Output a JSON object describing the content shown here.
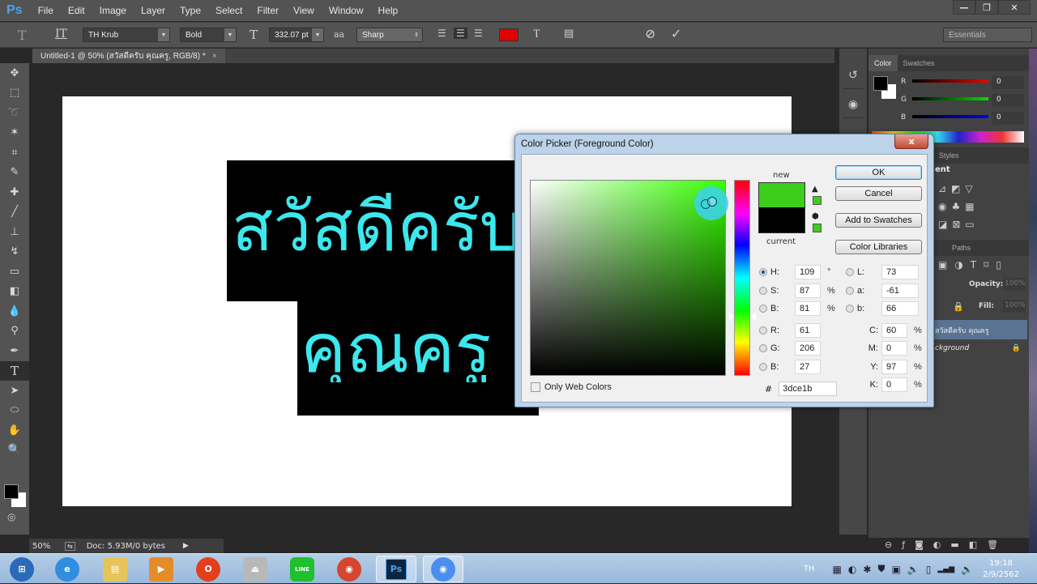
{
  "app": {
    "logo": "Ps",
    "menu": [
      "File",
      "Edit",
      "Image",
      "Layer",
      "Type",
      "Select",
      "Filter",
      "View",
      "Window",
      "Help"
    ],
    "window_controls": {
      "minimize": "—",
      "restore": "❐",
      "close": "✕"
    }
  },
  "options_bar": {
    "tool_icon": "T",
    "orientation_icon": "IT",
    "font_family": "TH Krub",
    "font_style": "Bold",
    "font_size": "332.07 pt",
    "aa_icon": "aa",
    "antialias": "Sharp",
    "align": [
      "align-left",
      "align-center",
      "align-right"
    ],
    "text_color": "#e00000",
    "warp_icon": "warp-text",
    "panels_icon": "character-panels",
    "cancel_icon": "⊘",
    "commit_icon": "✓",
    "workspace": "Essentials"
  },
  "document": {
    "tab_title": "Untitled-1 @ 50% (สวัสดีครับ คุณครู, RGB/8) *",
    "tab_close": "×",
    "line1": "สวัสดีครับ",
    "line2": "คุณครู",
    "text_color": "#3ce8ee",
    "bg_color": "#000000"
  },
  "tools": [
    "move",
    "marquee",
    "lasso",
    "magic-wand",
    "crop",
    "eyedropper",
    "healing",
    "brush",
    "clone-stamp",
    "history-brush",
    "eraser",
    "paint-bucket",
    "blur",
    "dodge",
    "pen",
    "type",
    "path-selection",
    "ellipse",
    "hand",
    "zoom"
  ],
  "tool_glyphs": [
    "✥",
    "⬚",
    "➰",
    "✶",
    "⌗",
    "✎",
    "✚",
    "╱",
    "⊥",
    "↯",
    "▭",
    "◧",
    "💧",
    "⚲",
    "✒",
    "T",
    "➤",
    "⬭",
    "✋",
    "🔍"
  ],
  "status": {
    "zoom": "50%",
    "doc": "Doc: 5.93M/0 bytes",
    "arrow": "▶"
  },
  "color_panel": {
    "tabs": [
      "Color",
      "Swatches"
    ],
    "channels": [
      {
        "label": "R",
        "value": "0"
      },
      {
        "label": "G",
        "value": "0"
      },
      {
        "label": "B",
        "value": "0"
      }
    ]
  },
  "adjustments_panel": {
    "tab": "Styles",
    "title": "ent"
  },
  "layers_panel": {
    "tabs": [
      "Paths"
    ],
    "opacity_label": "Opacity:",
    "opacity": "100%",
    "fill_label": "Fill:",
    "fill": "100%",
    "layers": [
      {
        "name": "สวัสดีครับ คุณครู",
        "selected": true
      },
      {
        "name": "ckground",
        "locked": true
      }
    ],
    "footer_icons": [
      "link",
      "fx",
      "mask",
      "adjustment",
      "group",
      "new-layer",
      "trash"
    ]
  },
  "color_picker": {
    "title": "Color Picker (Foreground Color)",
    "close": "x",
    "new_label": "new",
    "current_label": "current",
    "new_color": "#3dce1b",
    "current_color": "#000000",
    "buttons": {
      "ok": "OK",
      "cancel": "Cancel",
      "add_swatches": "Add to Swatches",
      "libraries": "Color Libraries"
    },
    "hsb": [
      {
        "label": "H:",
        "value": "109",
        "unit": "°",
        "selected": true
      },
      {
        "label": "S:",
        "value": "87",
        "unit": "%"
      },
      {
        "label": "B:",
        "value": "81",
        "unit": "%"
      }
    ],
    "rgb": [
      {
        "label": "R:",
        "value": "61"
      },
      {
        "label": "G:",
        "value": "206"
      },
      {
        "label": "B:",
        "value": "27"
      }
    ],
    "lab": [
      {
        "label": "L:",
        "value": "73"
      },
      {
        "label": "a:",
        "value": "-61"
      },
      {
        "label": "b:",
        "value": "66"
      }
    ],
    "cmyk": [
      {
        "label": "C:",
        "value": "60",
        "unit": "%"
      },
      {
        "label": "M:",
        "value": "0",
        "unit": "%"
      },
      {
        "label": "Y:",
        "value": "97",
        "unit": "%"
      },
      {
        "label": "K:",
        "value": "0",
        "unit": "%"
      }
    ],
    "only_web_colors": "Only Web Colors",
    "only_web_checked": false,
    "hex_label": "#",
    "hex": "3dce1b",
    "hue_fraction": 0.3
  },
  "taskbar": {
    "apps": [
      {
        "name": "start",
        "glyph": "⊞",
        "color": "#2a6ab8"
      },
      {
        "name": "internet-explorer",
        "glyph": "e",
        "color": "#2f8ee0"
      },
      {
        "name": "file-explorer",
        "glyph": "▤",
        "color": "#e7c45a"
      },
      {
        "name": "media-player",
        "glyph": "▶",
        "color": "#e58c2a"
      },
      {
        "name": "office",
        "glyph": "O",
        "color": "#e2401c"
      },
      {
        "name": "usb-drive",
        "glyph": "⏏",
        "color": "#b8b8b8"
      },
      {
        "name": "line",
        "glyph": "LINE",
        "color": "#1fbf2f"
      },
      {
        "name": "chrome-beta",
        "glyph": "◉",
        "color": "#d6452f"
      },
      {
        "name": "photoshop",
        "glyph": "Ps",
        "color": "#0b2540",
        "running": true
      },
      {
        "name": "chrome",
        "glyph": "◉",
        "color": "#4a8ef0",
        "running": true
      }
    ],
    "language": "TH",
    "tray": [
      "▦",
      "◐",
      "✱",
      "⛊",
      "▣",
      "🔈",
      "▯",
      "▂▄▆",
      "🔊"
    ],
    "time": "19:18",
    "date": "2/9/2562"
  }
}
